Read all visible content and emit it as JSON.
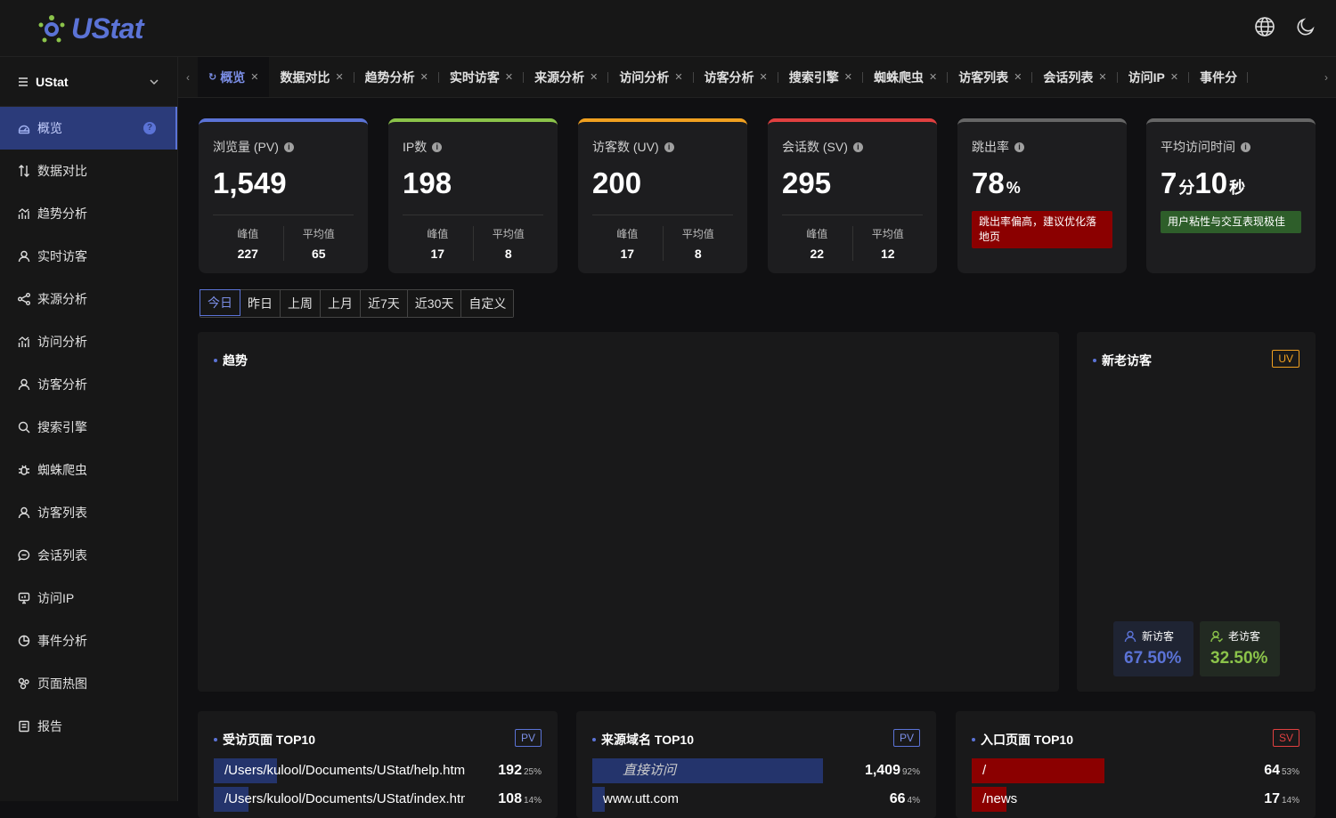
{
  "app": {
    "name": "UStat"
  },
  "sidebar": {
    "site": "UStat",
    "items": [
      {
        "label": "概览",
        "icon": "dashboard-icon",
        "active": true
      },
      {
        "label": "数据对比",
        "icon": "compare-icon"
      },
      {
        "label": "趋势分析",
        "icon": "trend-icon"
      },
      {
        "label": "实时访客",
        "icon": "user-icon"
      },
      {
        "label": "来源分析",
        "icon": "share-icon"
      },
      {
        "label": "访问分析",
        "icon": "trend-icon"
      },
      {
        "label": "访客分析",
        "icon": "user-icon"
      },
      {
        "label": "搜索引擎",
        "icon": "search-icon"
      },
      {
        "label": "蜘蛛爬虫",
        "icon": "bug-icon"
      },
      {
        "label": "访客列表",
        "icon": "user-icon"
      },
      {
        "label": "会话列表",
        "icon": "chat-icon"
      },
      {
        "label": "访问IP",
        "icon": "ip-icon"
      },
      {
        "label": "事件分析",
        "icon": "pie-icon"
      },
      {
        "label": "页面热图",
        "icon": "heatmap-icon"
      },
      {
        "label": "报告",
        "icon": "report-icon"
      }
    ]
  },
  "tabs": [
    "概览",
    "数据对比",
    "趋势分析",
    "实时访客",
    "来源分析",
    "访问分析",
    "访客分析",
    "搜索引擎",
    "蜘蛛爬虫",
    "访客列表",
    "会话列表",
    "访问IP",
    "事件分"
  ],
  "cards": [
    {
      "label": "浏览量 (PV)",
      "value": "1,549",
      "peak_label": "峰值",
      "peak": "227",
      "avg_label": "平均值",
      "avg": "65",
      "color": "#5b73d6"
    },
    {
      "label": "IP数",
      "value": "198",
      "peak_label": "峰值",
      "peak": "17",
      "avg_label": "平均值",
      "avg": "8",
      "color": "#8bc34a"
    },
    {
      "label": "访客数 (UV)",
      "value": "200",
      "peak_label": "峰值",
      "peak": "17",
      "avg_label": "平均值",
      "avg": "8",
      "color": "#f0a020"
    },
    {
      "label": "会话数 (SV)",
      "value": "295",
      "peak_label": "峰值",
      "peak": "22",
      "avg_label": "平均值",
      "avg": "12",
      "color": "#e04040"
    },
    {
      "label": "跳出率",
      "value": "78",
      "unit": "%",
      "note": "跳出率偏高，建议优化落地页",
      "note_color": "#8b0000",
      "color": "#666"
    },
    {
      "label": "平均访问时间",
      "value_min": "7",
      "unit_min": "分",
      "value_sec": "10",
      "unit_sec": "秒",
      "note": "用户粘性与交互表现极佳",
      "note_color": "#2e5e2a",
      "color": "#666"
    }
  ],
  "date_range": {
    "options": [
      "今日",
      "昨日",
      "上周",
      "上月",
      "近7天",
      "近30天",
      "自定义"
    ],
    "selected": "今日"
  },
  "trend_panel": {
    "title": "趋势"
  },
  "visitor_panel": {
    "title": "新老访客",
    "tag": "UV",
    "new_label": "新访客",
    "new_value": "67.50%",
    "old_label": "老访客",
    "old_value": "32.50%"
  },
  "top_pages": {
    "title": "受访页面 TOP10",
    "tag": "PV",
    "rows": [
      {
        "label": "/Users/kulool/Documents/UStat/help.html",
        "value": "192",
        "pct": "25%",
        "share": 0.25
      },
      {
        "label": "/Users/kulool/Documents/UStat/index.html",
        "value": "108",
        "pct": "14%",
        "share": 0.14
      }
    ]
  },
  "top_domains": {
    "title": "来源域名 TOP10",
    "tag": "PV",
    "rows": [
      {
        "label": "直接访问",
        "value": "1,409",
        "pct": "92%",
        "share": 0.92
      },
      {
        "label": "www.utt.com",
        "value": "66",
        "pct": "4%",
        "share": 0.04
      }
    ]
  },
  "top_entry": {
    "title": "入口页面 TOP10",
    "tag": "SV",
    "rows": [
      {
        "label": "/",
        "value": "64",
        "pct": "53%",
        "share": 0.53
      },
      {
        "label": "/news",
        "value": "17",
        "pct": "14%",
        "share": 0.14
      }
    ]
  },
  "colors": {
    "accent": "#5b73d6",
    "new_visitor": "#5b73d6",
    "old_visitor": "#8bc34a",
    "sv_red": "#e04040"
  }
}
